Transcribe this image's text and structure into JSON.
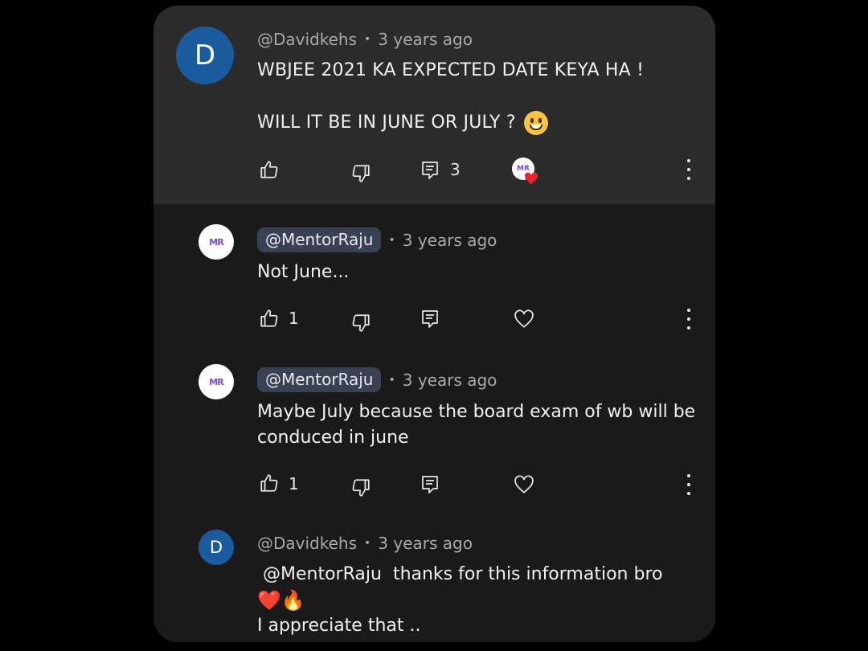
{
  "colors": {
    "page_bg": "#000000",
    "card_bg": "#1a1a1a",
    "highlight_bg": "#2b2b2b",
    "avatar_blue": "#1a5b9e",
    "pill_bg": "#3a4152",
    "heart_red": "#e3262c"
  },
  "top_comment": {
    "avatar_letter": "D",
    "author": "@Davidkehs",
    "separator": "•",
    "time": "3 years ago",
    "line1": "WBJEE 2021 KA EXPECTED DATE KEYA HA !",
    "line2": "WILL IT BE IN JUNE OR JULY ?",
    "emoji": "😀",
    "reply_count": "3",
    "icons": [
      "thumbs-up-icon",
      "thumbs-down-icon",
      "reply-icon",
      "creator-heart-badge",
      "more-options-icon"
    ]
  },
  "replies": [
    {
      "author": "@MentorRaju",
      "separator": "•",
      "time": "3 years ago",
      "text": "Not June...",
      "like_count": "1",
      "avatar": "channel-logo"
    },
    {
      "author": "@MentorRaju",
      "separator": "•",
      "time": "3 years ago",
      "text": "Maybe July because the board exam of wb will be conduced in june",
      "like_count": "1",
      "avatar": "channel-logo"
    },
    {
      "author": "@Davidkehs",
      "separator": "•",
      "time": "3 years ago",
      "avatar_letter": "D",
      "mention": "@MentorRaju",
      "text_rest": "thanks for this information bro",
      "emojis": "❤️🔥",
      "line_last": "I appreciate that .."
    }
  ]
}
